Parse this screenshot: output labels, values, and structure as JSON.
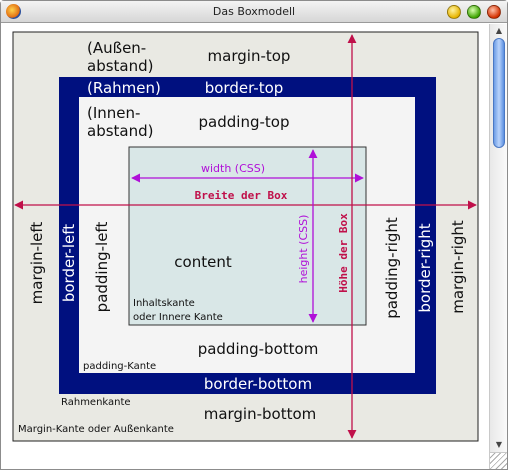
{
  "window": {
    "title": "Das Boxmodell"
  },
  "diagram": {
    "margin_note_1": "(Außen-",
    "margin_note_2": "abstand)",
    "margin_top": "margin-top",
    "border_note": "(Rahmen)",
    "border_top": "border-top",
    "padding_note_1": "(Innen-",
    "padding_note_2": "abstand)",
    "padding_top": "padding-top",
    "width_css": "width (CSS)",
    "breite_der_box": "Breite der Box",
    "height_css": "height (CSS)",
    "hoehe_der_box": "Höhe der Box",
    "content": "content",
    "inhaltskante_1": "Inhaltskante",
    "inhaltskante_2": "oder Innere Kante",
    "margin_left": "margin-left",
    "border_left": "border-left",
    "padding_left": "padding-left",
    "padding_right": "padding-right",
    "border_right": "border-right",
    "margin_right": "margin-right",
    "padding_bottom": "padding-bottom",
    "padding_kante": "padding-Kante",
    "border_bottom": "border-bottom",
    "rahmenkante": "Rahmenkante",
    "margin_bottom": "margin-bottom",
    "margin_kante": "Margin-Kante oder Außenkante"
  },
  "colors": {
    "margin_area": "#e9e9e3",
    "border_area": "#00107f",
    "padding_area": "#f4f4f4",
    "content_area": "#d9e7e7",
    "arrow_crimson": "#c0104a",
    "arrow_purple": "#b010d8"
  },
  "icons": [
    "firefox-app-icon",
    "minimize-button",
    "zoom-button",
    "close-button",
    "scroll-up-arrow",
    "scroll-down-arrow",
    "resize-grip"
  ]
}
